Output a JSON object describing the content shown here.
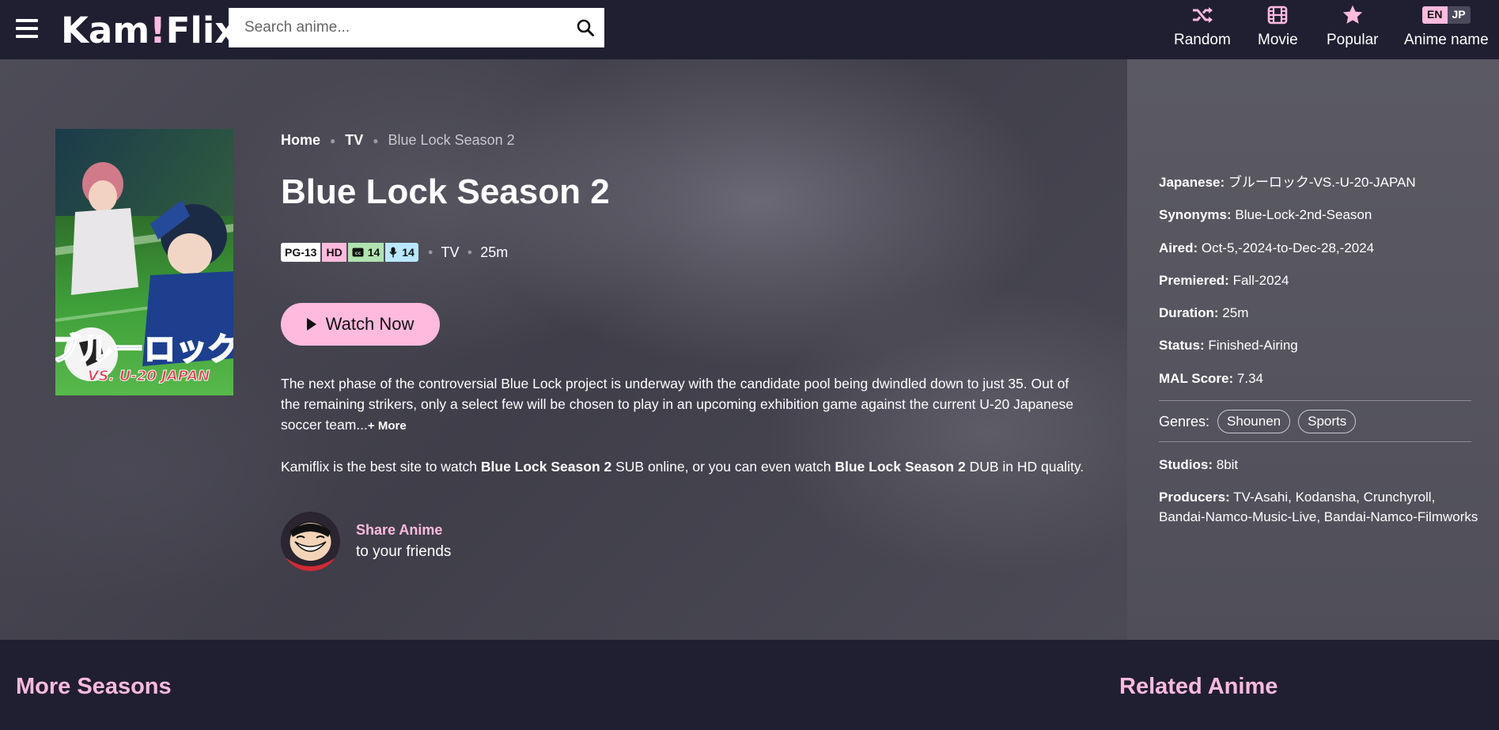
{
  "header": {
    "logo_text": "Kam",
    "logo_bang": "!",
    "logo_text2": "Flix",
    "search_placeholder": "Search anime...",
    "nav": [
      {
        "label": "Random",
        "icon": "shuffle-icon"
      },
      {
        "label": "Movie",
        "icon": "film-icon"
      },
      {
        "label": "Popular",
        "icon": "star-icon"
      },
      {
        "label": "Anime name",
        "icon": "language-toggle"
      }
    ],
    "lang_en": "EN",
    "lang_jp": "JP"
  },
  "breadcrumb": {
    "home": "Home",
    "type": "TV",
    "current": "Blue Lock Season 2"
  },
  "anime": {
    "title": "Blue Lock Season 2",
    "rating": "PG-13",
    "quality": "HD",
    "sub_count": "14",
    "dub_count": "14",
    "type": "TV",
    "duration": "25m",
    "watch_label": "Watch Now",
    "description": "The next phase of the controversial Blue Lock project is underway with the candidate pool being dwindled down to just 35. Out of the remaining strikers, only a select few will be chosen to play in an upcoming exhibition game against the current U-20 Japanese soccer team...",
    "more_label": "+ More",
    "promo_prefix": "Kamiflix is the best site to watch ",
    "promo_name": "Blue Lock Season 2",
    "promo_middle": " SUB online, or you can even watch ",
    "promo_suffix": " DUB in HD quality.",
    "poster_text": "ブルーロック",
    "poster_sub": "VS. U-20 JAPAN"
  },
  "share": {
    "title": "Share Anime",
    "subtitle": "to your friends"
  },
  "info": {
    "japanese_label": "Japanese:",
    "japanese_value": "ブルーロック-VS.-U-20-JAPAN",
    "synonyms_label": "Synonyms:",
    "synonyms_value": "Blue-Lock-2nd-Season",
    "aired_label": "Aired:",
    "aired_value": "Oct-5,-2024-to-Dec-28,-2024",
    "premiered_label": "Premiered:",
    "premiered_value": "Fall-2024",
    "duration_label": "Duration:",
    "duration_value": "25m",
    "status_label": "Status:",
    "status_value": "Finished-Airing",
    "mal_label": "MAL Score:",
    "mal_value": "7.34",
    "genres_label": "Genres:",
    "genres": [
      "Shounen",
      "Sports"
    ],
    "studios_label": "Studios:",
    "studios_value": "8bit",
    "producers_label": "Producers:",
    "producers_value1": "TV-Asahi, Kodansha, Crunchyroll,",
    "producers_value2": "Bandai-Namco-Music-Live, Bandai-Namco-Filmworks"
  },
  "sections": {
    "more_seasons": "More Seasons",
    "related": "Related Anime"
  },
  "colors": {
    "accent": "#ffbade",
    "background": "#201f31"
  }
}
